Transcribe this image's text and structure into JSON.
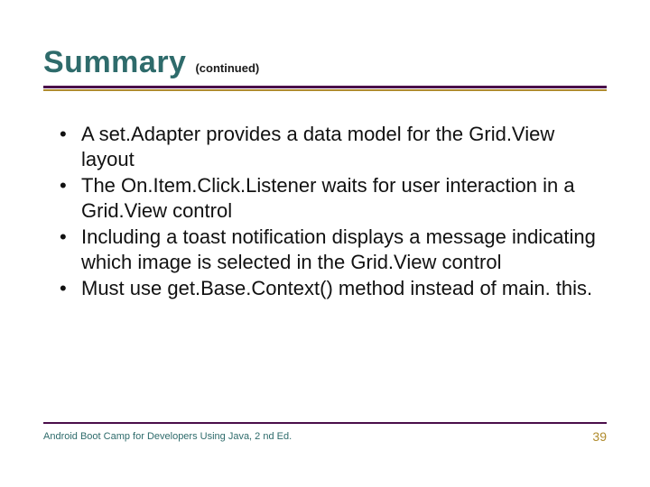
{
  "header": {
    "title": "Summary",
    "continued": "(continued)"
  },
  "bullets": [
    "A set.Adapter provides a data model for the Grid.View layout",
    "The On.Item.Click.Listener waits for user interaction in a Grid.View control",
    "Including a toast notification displays a message indicating which image is selected in the Grid.View control",
    "Must use get.Base.Context() method instead of main. this."
  ],
  "footer": {
    "text": "Android Boot Camp for Developers Using Java, 2 nd Ed.",
    "page": "39"
  },
  "colors": {
    "title": "#2e6b6b",
    "rule_dark": "#4a0e4a",
    "rule_gold": "#b08c2e"
  }
}
